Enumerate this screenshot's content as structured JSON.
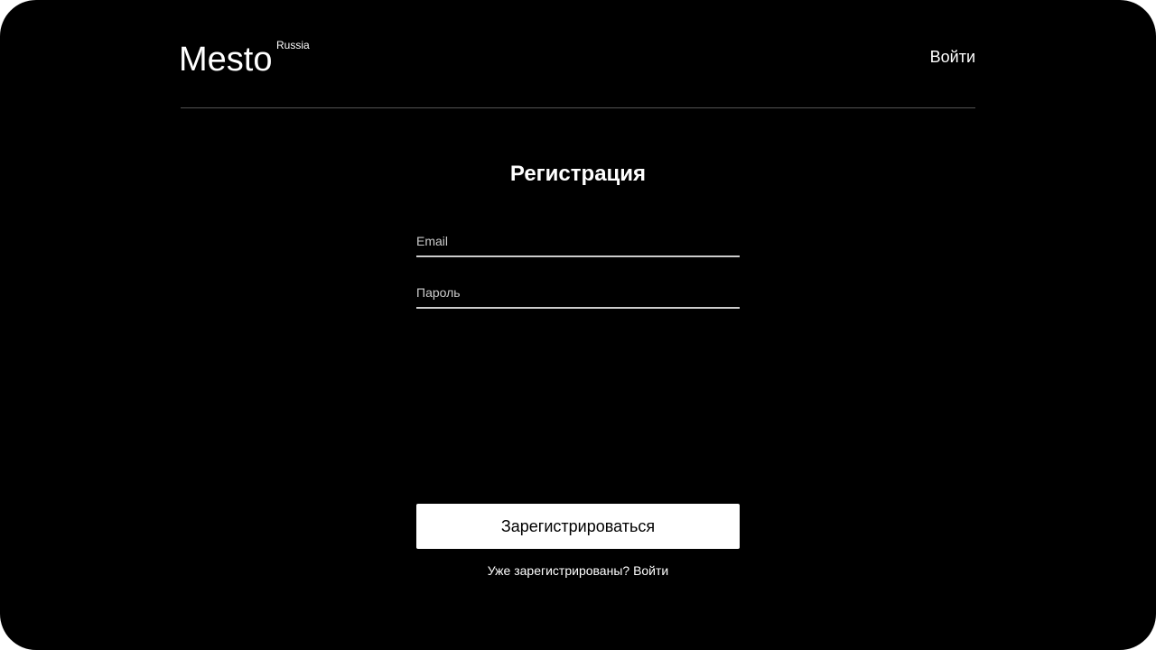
{
  "header": {
    "logo_text": "Mesto",
    "logo_sup": "Russia",
    "login_link": "Войти"
  },
  "form": {
    "title": "Регистрация",
    "email": {
      "value": "",
      "placeholder": "Email"
    },
    "password": {
      "value": "",
      "placeholder": "Пароль"
    },
    "submit_label": "Зарегистрироваться",
    "hint_text": "Уже зарегистрированы?",
    "hint_link": "Войти"
  },
  "colors": {
    "background": "#000000",
    "text": "#ffffff",
    "field_border": "#cccccc",
    "divider": "#545454",
    "button_bg": "#ffffff",
    "button_text": "#000000"
  }
}
